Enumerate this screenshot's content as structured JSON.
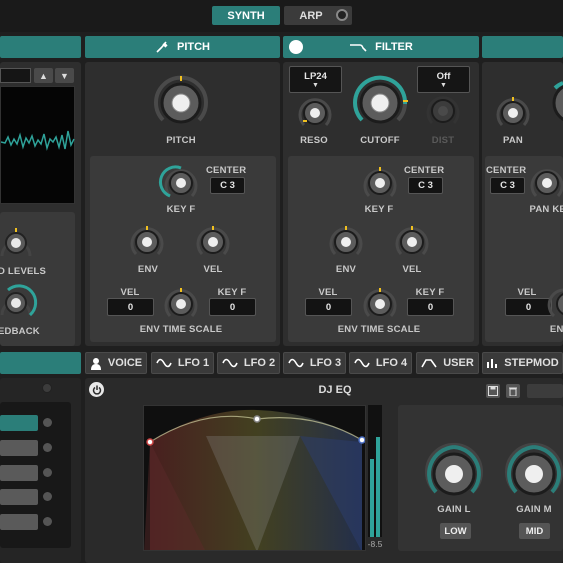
{
  "top_tabs": {
    "synth": "SYNTH",
    "arp": "ARP"
  },
  "sections": {
    "pitch": "PITCH",
    "filter": "FILTER"
  },
  "pitch": {
    "knob_label": "PITCH",
    "center_label": "CENTER",
    "center_value": "C 3",
    "keyf_label": "KEY F",
    "env_label": "ENV",
    "vel_label": "VEL",
    "vel_small_label": "VEL",
    "vel_value": "0",
    "keyf_small_label": "KEY F",
    "keyf_value": "0",
    "env_time_scale": "ENV TIME SCALE"
  },
  "filter": {
    "type_value": "LP24",
    "dist_value": "Off",
    "reso_label": "RESO",
    "cutoff_label": "CUTOFF",
    "dist_label": "DIST",
    "center_label": "CENTER",
    "center_value": "C 3",
    "keyf_label": "KEY F",
    "env_label": "ENV",
    "vel_label": "VEL",
    "vel_small_label": "VEL",
    "vel_value": "0",
    "keyf_small_label": "KEY F",
    "keyf_value": "0",
    "env_time_scale": "ENV TIME SCALE"
  },
  "amp": {
    "pan_label": "PAN",
    "center_label": "CENTER",
    "center_value": "C 3",
    "pan_key_label": "PAN KEY",
    "vel_label": "VEL",
    "vel_value": "0",
    "env_label": "ENV"
  },
  "left": {
    "levels_label": "D LEVELS",
    "feedback_label": "EDBACK"
  },
  "bottom_tabs": [
    "VOICE",
    "LFO 1",
    "LFO 2",
    "LFO 3",
    "LFO 4",
    "USER",
    "STEPMOD"
  ],
  "eq": {
    "title": "DJ EQ",
    "meter_value": "-8.5",
    "gain_l_label": "GAIN L",
    "gain_m_label": "GAIN M",
    "low_label": "LOW",
    "mid_label": "MID"
  },
  "colors": {
    "accent": "#2b7e79",
    "knob_arc": "#2fa39a",
    "indicator": "#f0c020"
  }
}
